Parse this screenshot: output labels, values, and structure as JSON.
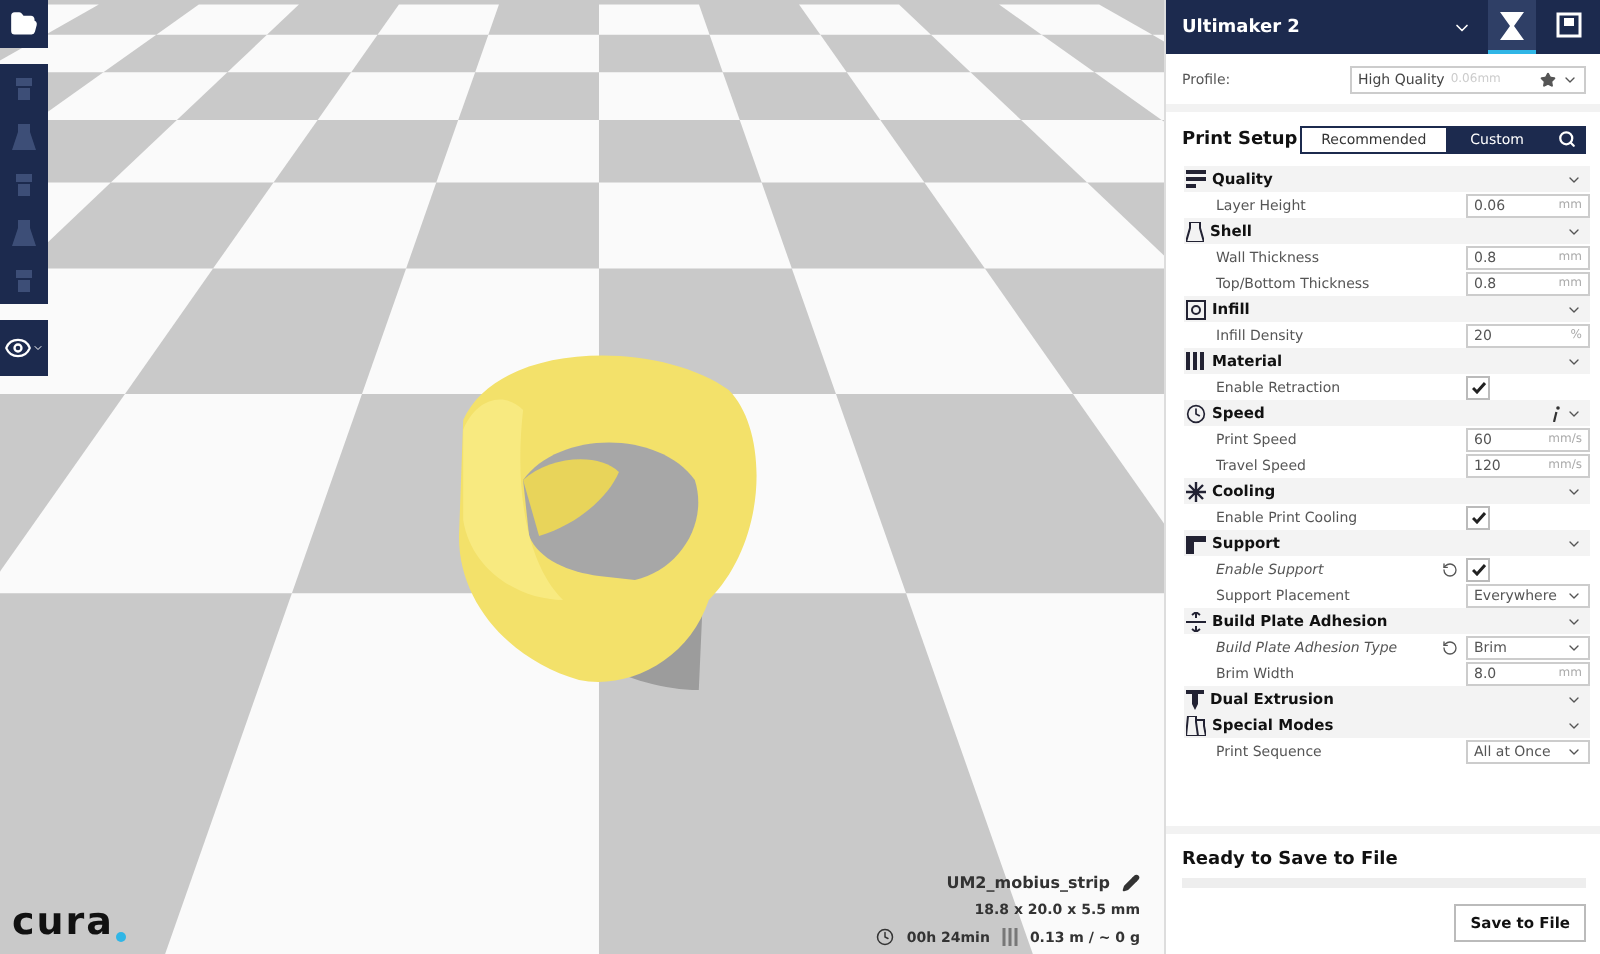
{
  "toolbar": {
    "tools": [
      {
        "selected": false
      },
      {
        "selected": false
      },
      {
        "selected": false
      },
      {
        "selected": false
      },
      {
        "selected": false
      }
    ]
  },
  "logo": {
    "text": "cura"
  },
  "model": {
    "name": "UM2_mobius_strip",
    "dimensions": "18.8 x 20.0 x 5.5 mm",
    "print_time": "00h 24min",
    "material": "0.13 m / ~ 0 g"
  },
  "panel": {
    "printer": "Ultimaker 2",
    "header_tabs": [
      {
        "kind": "setup",
        "selected": true
      },
      {
        "kind": "monitor",
        "selected": false
      }
    ],
    "profile": {
      "label": "Profile:",
      "value": "High Quality",
      "hint": "0.06mm"
    },
    "print_setup": {
      "title": "Print Setup",
      "modes": [
        {
          "label": "Recommended",
          "selected": false
        },
        {
          "label": "Custom",
          "selected": true
        }
      ]
    },
    "categories": [
      {
        "kind": "quality",
        "title": "Quality",
        "info": false,
        "settings": [
          {
            "kind": "number",
            "label": "Layer Height",
            "value": "0.06",
            "unit": "mm",
            "overridden": false
          }
        ]
      },
      {
        "kind": "shell",
        "title": "Shell",
        "info": false,
        "settings": [
          {
            "kind": "number",
            "label": "Wall Thickness",
            "value": "0.8",
            "unit": "mm",
            "overridden": false
          },
          {
            "kind": "number",
            "label": "Top/Bottom Thickness",
            "value": "0.8",
            "unit": "mm",
            "overridden": false
          }
        ]
      },
      {
        "kind": "infill",
        "title": "Infill",
        "info": false,
        "settings": [
          {
            "kind": "number",
            "label": "Infill Density",
            "value": "20",
            "unit": "%",
            "overridden": false
          }
        ]
      },
      {
        "kind": "material",
        "title": "Material",
        "info": false,
        "settings": [
          {
            "kind": "checkbox",
            "label": "Enable Retraction",
            "checked": true,
            "overridden": false
          }
        ]
      },
      {
        "kind": "speed",
        "title": "Speed",
        "info": true,
        "settings": [
          {
            "kind": "number",
            "label": "Print Speed",
            "value": "60",
            "unit": "mm/s",
            "overridden": false
          },
          {
            "kind": "number",
            "label": "Travel Speed",
            "value": "120",
            "unit": "mm/s",
            "overridden": false
          }
        ]
      },
      {
        "kind": "cooling",
        "title": "Cooling",
        "info": false,
        "settings": [
          {
            "kind": "checkbox",
            "label": "Enable Print Cooling",
            "checked": true,
            "overridden": false
          }
        ]
      },
      {
        "kind": "support",
        "title": "Support",
        "info": false,
        "settings": [
          {
            "kind": "checkbox",
            "label": "Enable Support",
            "checked": true,
            "overridden": true
          },
          {
            "kind": "select",
            "label": "Support Placement",
            "value": "Everywhere",
            "overridden": false
          }
        ]
      },
      {
        "kind": "adhesion",
        "title": "Build Plate Adhesion",
        "info": false,
        "settings": [
          {
            "kind": "select",
            "label": "Build Plate Adhesion Type",
            "value": "Brim",
            "overridden": true
          },
          {
            "kind": "number",
            "label": "Brim Width",
            "value": "8.0",
            "unit": "mm",
            "overridden": false
          }
        ]
      },
      {
        "kind": "dual",
        "title": "Dual Extrusion",
        "info": false
      },
      {
        "kind": "special",
        "title": "Special Modes",
        "info": false,
        "settings": [
          {
            "kind": "select",
            "label": "Print Sequence",
            "value": "All at Once",
            "overridden": false
          }
        ]
      }
    ],
    "status": {
      "title": "Ready to Save to File",
      "level": 0,
      "button": "Save to File"
    }
  }
}
